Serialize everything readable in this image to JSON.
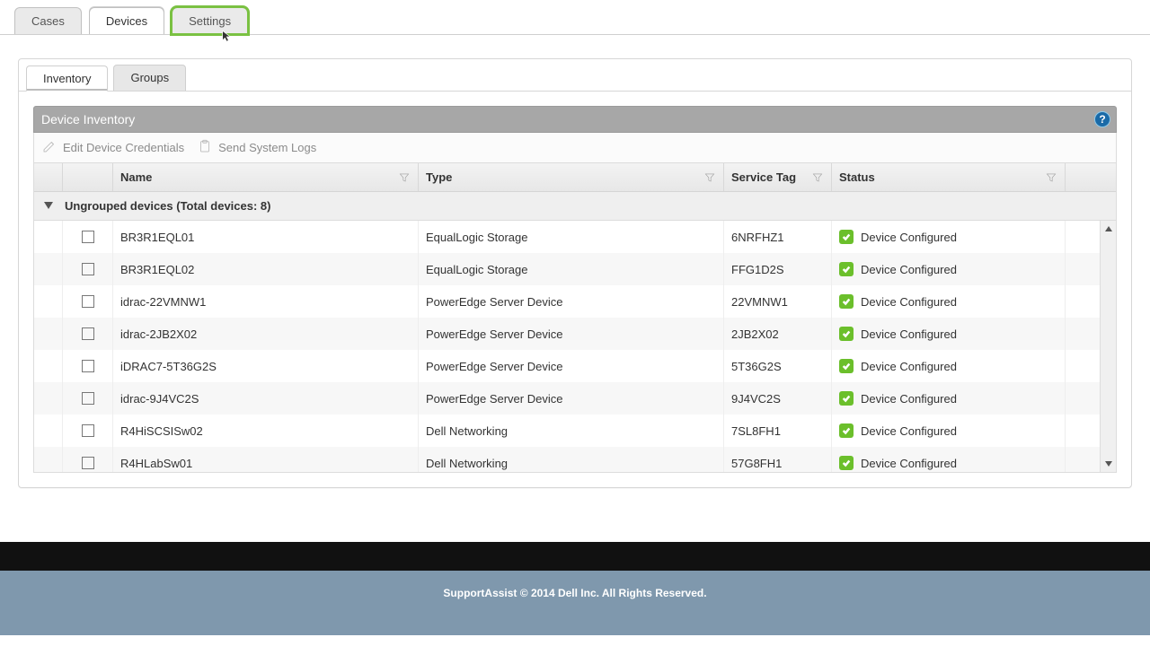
{
  "topTabs": [
    {
      "label": "Cases"
    },
    {
      "label": "Devices"
    },
    {
      "label": "Settings"
    }
  ],
  "subTabs": [
    {
      "label": "Inventory"
    },
    {
      "label": "Groups"
    }
  ],
  "panel": {
    "title": "Device Inventory",
    "help": "?"
  },
  "toolbar": {
    "edit": "Edit Device Credentials",
    "send": "Send System Logs"
  },
  "columns": {
    "name": "Name",
    "type": "Type",
    "service": "Service Tag",
    "status": "Status"
  },
  "group": {
    "label": "Ungrouped devices (Total devices: 8)"
  },
  "statusOk": "Device Configured",
  "rows": [
    {
      "name": "BR3R1EQL01",
      "type": "EqualLogic Storage",
      "service": "6NRFHZ1"
    },
    {
      "name": "BR3R1EQL02",
      "type": "EqualLogic Storage",
      "service": "FFG1D2S"
    },
    {
      "name": "idrac-22VMNW1",
      "type": "PowerEdge Server Device",
      "service": "22VMNW1"
    },
    {
      "name": "idrac-2JB2X02",
      "type": "PowerEdge Server Device",
      "service": "2JB2X02"
    },
    {
      "name": "iDRAC7-5T36G2S",
      "type": "PowerEdge Server Device",
      "service": "5T36G2S"
    },
    {
      "name": "idrac-9J4VC2S",
      "type": "PowerEdge Server Device",
      "service": "9J4VC2S"
    },
    {
      "name": "R4HiSCSISw02",
      "type": "Dell Networking",
      "service": "7SL8FH1"
    },
    {
      "name": "R4HLabSw01",
      "type": "Dell Networking",
      "service": "57G8FH1"
    }
  ],
  "footer": {
    "text": "SupportAssist © 2014 Dell Inc. All Rights Reserved."
  }
}
